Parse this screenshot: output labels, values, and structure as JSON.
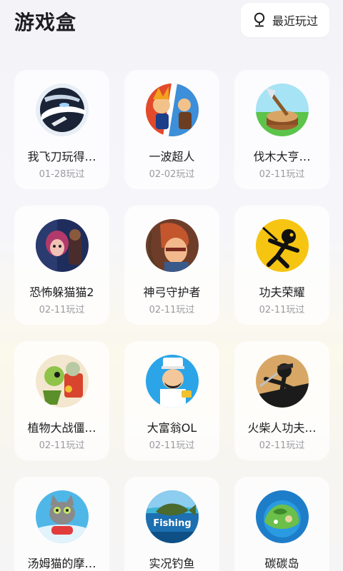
{
  "header": {
    "title": "游戏盒",
    "recent_label": "最近玩过",
    "recent_icon": "bulb-icon"
  },
  "games": [
    {
      "name": "我飞刀玩得…",
      "date": "01-28玩过",
      "icon": "knife-hit-icon",
      "colors": [
        "#1a2436",
        "#9fd3ff"
      ]
    },
    {
      "name": "一波超人",
      "date": "02-02玩过",
      "icon": "superhero-icon",
      "colors": [
        "#e24a2b",
        "#3c8fd8"
      ]
    },
    {
      "name": "伐木大亨…",
      "date": "02-11玩过",
      "icon": "lumber-axe-icon",
      "colors": [
        "#5cc44a",
        "#a6e3f5"
      ]
    },
    {
      "name": "恐怖躲猫猫2",
      "date": "02-11玩过",
      "icon": "horror-girl-icon",
      "colors": [
        "#1f2d5c",
        "#b23a6b"
      ]
    },
    {
      "name": "神弓守护者",
      "date": "02-11玩过",
      "icon": "archer-icon",
      "colors": [
        "#c4562e",
        "#6e3d2a"
      ]
    },
    {
      "name": "功夫荣耀",
      "date": "02-11玩过",
      "icon": "stickman-icon",
      "colors": [
        "#f5c511",
        "#111111"
      ]
    },
    {
      "name": "植物大战僵…",
      "date": "02-11玩过",
      "icon": "plants-zombies-icon",
      "colors": [
        "#d8442d",
        "#8fc34a"
      ]
    },
    {
      "name": "大富翁OL",
      "date": "02-11玩过",
      "icon": "tycoon-icon",
      "colors": [
        "#2ba5e8",
        "#f3c79a"
      ]
    },
    {
      "name": "火柴人功夫…",
      "date": "02-11玩过",
      "icon": "stick-fighter-icon",
      "colors": [
        "#d8a765",
        "#1b1b1b"
      ]
    },
    {
      "name": "汤姆猫的摩…",
      "date": "",
      "icon": "talking-tom-icon",
      "colors": [
        "#4fb7e8",
        "#8a8a8a"
      ]
    },
    {
      "name": "实况钓鱼",
      "date": "",
      "icon": "fishing-icon",
      "colors": [
        "#1c6fb0",
        "#3db5d8"
      ]
    },
    {
      "name": "碳碳岛",
      "date": "",
      "icon": "island-icon",
      "colors": [
        "#1e7dc9",
        "#6bbf4a"
      ]
    }
  ],
  "fishing_text": "Fishing"
}
